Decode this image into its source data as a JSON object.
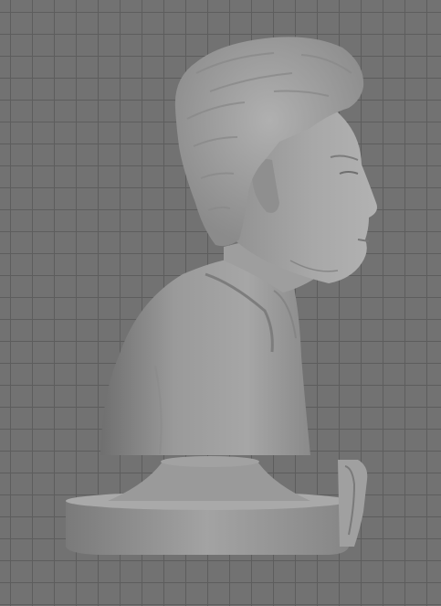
{
  "viewport": {
    "background_color": "#727272",
    "grid_line_color": "#5d5d5d",
    "model_color": "#9c9c9c"
  },
  "scene": {
    "objects": [
      "bust-head",
      "bust-torso",
      "pedestal-base",
      "separate-part-piece"
    ]
  }
}
